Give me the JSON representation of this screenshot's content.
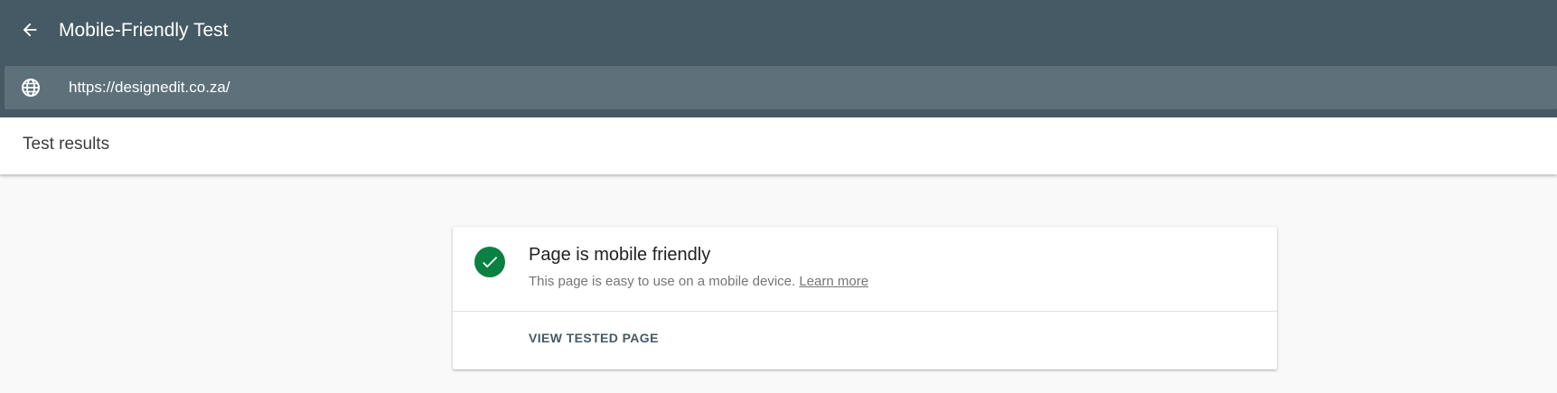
{
  "header": {
    "title": "Mobile-Friendly Test",
    "back_icon": "arrow-back-icon"
  },
  "url_bar": {
    "icon": "globe-icon",
    "value": "https://designedit.co.za/"
  },
  "results": {
    "title": "Test results"
  },
  "result_card": {
    "status_icon": "check-circle-icon",
    "title": "Page is mobile friendly",
    "description": "This page is easy to use on a mobile device.",
    "learn_more_label": "Learn more",
    "action_label": "VIEW TESTED PAGE"
  },
  "colors": {
    "header_bg": "#455a64",
    "url_bar_bg": "#5e717b",
    "success_green": "#0b8043",
    "page_bg": "#f9f9f9"
  }
}
